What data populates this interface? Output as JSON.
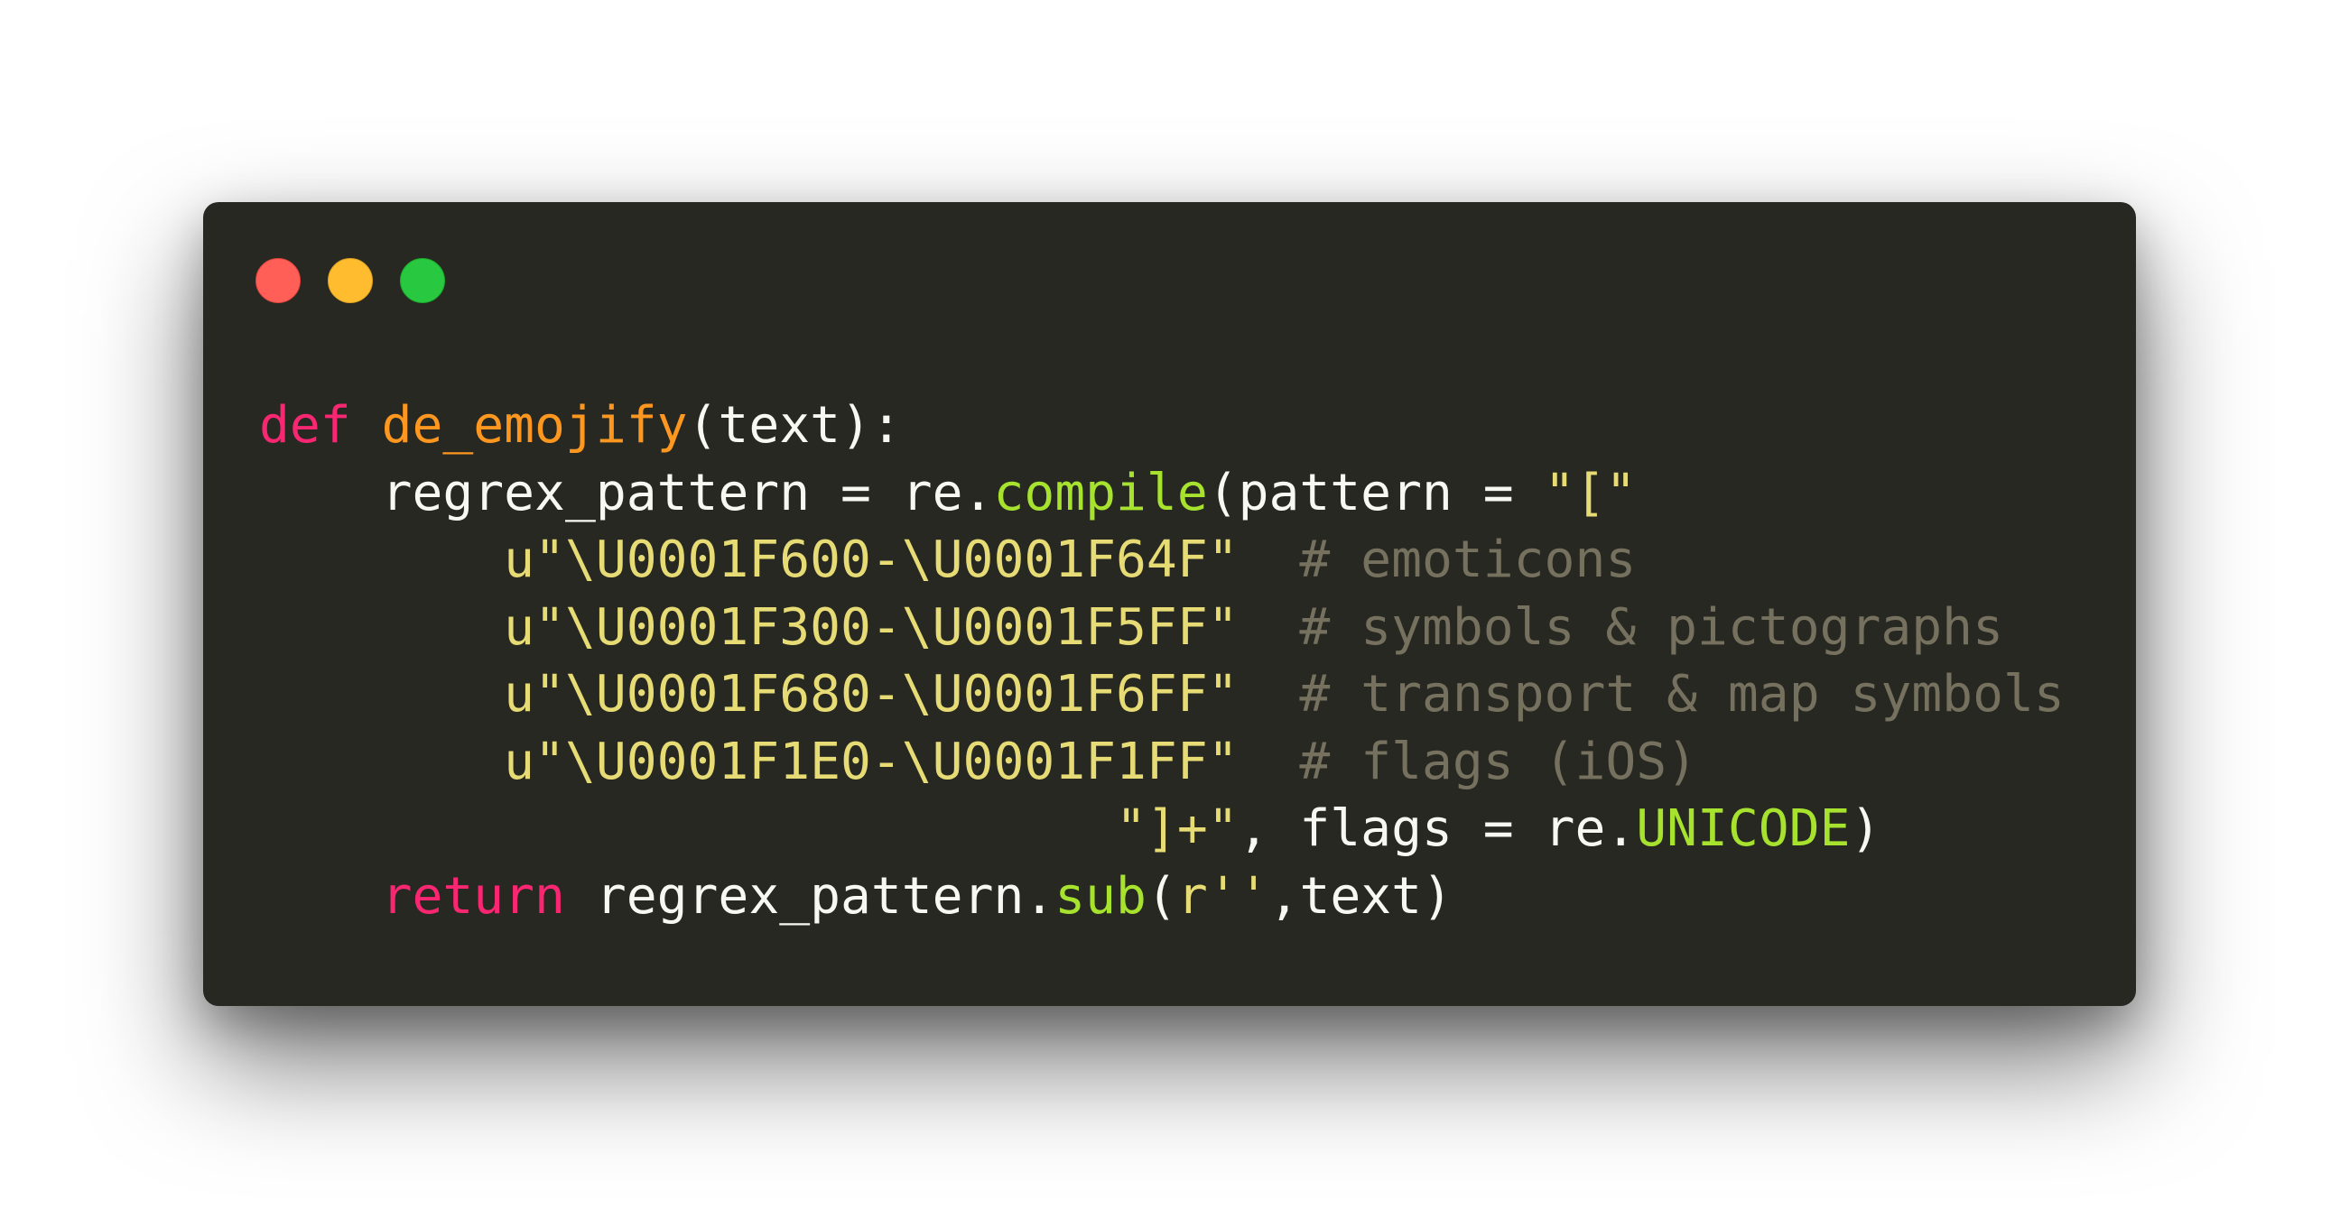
{
  "window": {
    "controls": [
      {
        "name": "close",
        "color": "#ff5f57"
      },
      {
        "name": "minimize",
        "color": "#febc2e"
      },
      {
        "name": "maximize",
        "color": "#28c840"
      }
    ]
  },
  "theme": {
    "background": "#272822",
    "keyword": "#f92672",
    "function_name": "#fd971f",
    "call": "#a6e22e",
    "string": "#e6db74",
    "comment": "#75715e",
    "text": "#f8f8f2"
  },
  "code": {
    "l1": {
      "kw": "def",
      "sp1": " ",
      "fn": "de_emojify",
      "rest": "(text):"
    },
    "l2": {
      "indent": "    ",
      "a": "regrex_pattern = re.",
      "call": "compile",
      "b": "(pattern = ",
      "str": "\"[\""
    },
    "l3": {
      "indent": "        ",
      "str": "u\"\\U0001F600-\\U0001F64F\"",
      "gap": "  ",
      "cmt": "# emoticons"
    },
    "l4": {
      "indent": "        ",
      "str": "u\"\\U0001F300-\\U0001F5FF\"",
      "gap": "  ",
      "cmt": "# symbols & pictographs"
    },
    "l5": {
      "indent": "        ",
      "str": "u\"\\U0001F680-\\U0001F6FF\"",
      "gap": "  ",
      "cmt": "# transport & map symbols"
    },
    "l6": {
      "indent": "        ",
      "str": "u\"\\U0001F1E0-\\U0001F1FF\"",
      "gap": "  ",
      "cmt": "# flags (iOS)"
    },
    "l7": {
      "indent": "                            ",
      "str": "\"]+\"",
      "a": ", flags = re.",
      "call": "UNICODE",
      "b": ")"
    },
    "l8": {
      "indent": "    ",
      "kw": "return",
      "a": " regrex_pattern.",
      "call": "sub",
      "b": "(",
      "str": "r''",
      "c": ",text)"
    }
  }
}
